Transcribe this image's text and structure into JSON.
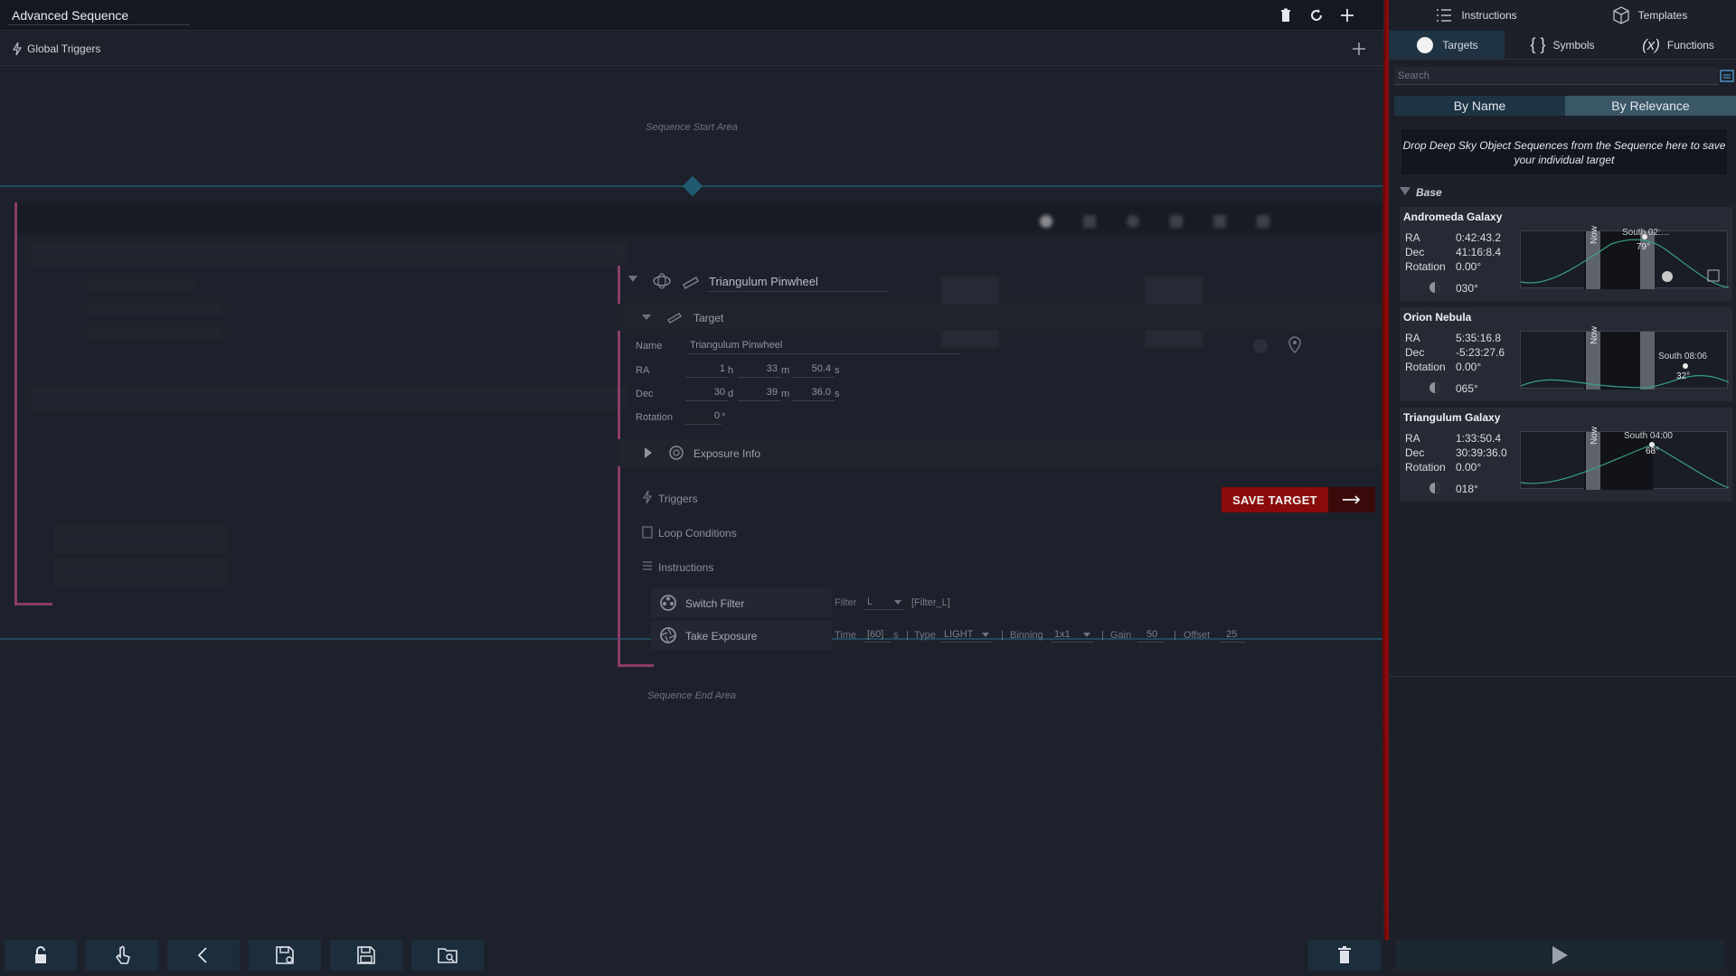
{
  "window": {
    "title": "Advanced Sequence"
  },
  "global_triggers": {
    "label": "Global Triggers"
  },
  "areas": {
    "start": "Sequence Start Area",
    "end": "Sequence End Area"
  },
  "target_container": {
    "name": "Triangulum Pinwheel",
    "target_section": "Target",
    "fields": {
      "name_label": "Name",
      "name_value": "Triangulum Pinwheel",
      "ra_label": "RA",
      "ra_h": "1",
      "ra_h_unit": "h",
      "ra_m": "33",
      "ra_m_unit": "m",
      "ra_s": "50.4",
      "ra_s_unit": "s",
      "dec_label": "Dec",
      "dec_d": "30",
      "dec_d_unit": "d",
      "dec_m": "39",
      "dec_m_unit": "m",
      "dec_s": "36.0",
      "dec_s_unit": "s",
      "rotation_label": "Rotation",
      "rotation_value": "0",
      "rotation_unit": "°"
    },
    "exposure_info": "Exposure Info",
    "triggers": "Triggers",
    "loop_conditions": "Loop Conditions",
    "instructions": "Instructions",
    "save_target": "SAVE TARGET",
    "instruction_items": [
      {
        "label": "Switch Filter",
        "params": {
          "filter_label": "Filter",
          "filter_value": "L",
          "filter_name": "[Filter_L]"
        }
      },
      {
        "label": "Take Exposure",
        "params": {
          "time_label": "Time",
          "time_value": "[60]",
          "time_unit": "s",
          "type_label": "Type",
          "type_value": "LIGHT",
          "binning_label": "Binning",
          "binning_value": "1x1",
          "gain_label": "Gain",
          "gain_value": "50",
          "offset_label": "Offset",
          "offset_value": "25"
        }
      }
    ]
  },
  "right_panel": {
    "tabs_top": [
      {
        "label": "Instructions"
      },
      {
        "label": "Templates"
      }
    ],
    "tabs_second": [
      {
        "label": "Targets"
      },
      {
        "label": "Symbols"
      },
      {
        "label": "Functions"
      }
    ],
    "search_placeholder": "Search",
    "sort": {
      "by_name": "By Name",
      "by_relevance": "By Relevance"
    },
    "dropzone_text": "Drop Deep Sky Object Sequences from the Sequence here to save your individual target",
    "group": "Base",
    "targets": [
      {
        "name": "Andromeda Galaxy",
        "ra": "0:42:43.2",
        "dec": "41:16:8.4",
        "rotation": "0.00°",
        "azimuth": "030°",
        "chart_label": "South 02:…",
        "alt": "79°",
        "now": "Now"
      },
      {
        "name": "Orion Nebula",
        "ra": "5:35:16.8",
        "dec": "-5:23:27.6",
        "rotation": "0.00°",
        "azimuth": "065°",
        "chart_label": "South 08:06",
        "alt": "32°",
        "now": "Now"
      },
      {
        "name": "Triangulum Galaxy",
        "ra": "1:33:50.4",
        "dec": "30:39:36.0",
        "rotation": "0.00°",
        "azimuth": "018°",
        "chart_label": "South 04:00",
        "alt": "68°",
        "now": "Now"
      }
    ],
    "labels": {
      "ra": "RA",
      "dec": "Dec",
      "rotation": "Rotation"
    }
  },
  "colors": {
    "accent": "#1f5a70",
    "save": "#8b0a0a",
    "bracket": "#8c3c68"
  }
}
